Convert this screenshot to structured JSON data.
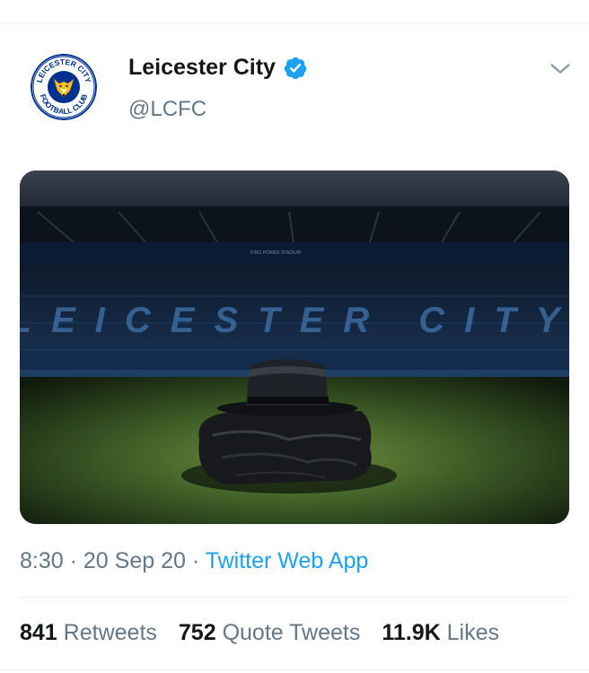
{
  "tweet": {
    "display_name": "Leicester City",
    "handle": "@LCFC",
    "time": "8:30",
    "date": "20 Sep 20",
    "source": "Twitter Web App",
    "separator": "·"
  },
  "stats": {
    "retweets_count": "841",
    "retweets_label": "Retweets",
    "quotes_count": "752",
    "quotes_label": "Quote Tweets",
    "likes_count": "11.9K",
    "likes_label": "Likes"
  },
  "media": {
    "stadium_sign": "KING POWER STADIUM",
    "stand_lettering": "LEICESTER CITY"
  },
  "avatar": {
    "badge_text_top": "LEICESTER CITY",
    "badge_text_bottom": "FOOTBALL CLUB"
  },
  "colors": {
    "accent": "#1da1f2",
    "secondary_text": "#657786",
    "primary_text": "#14171a",
    "divider": "#e6ecf0",
    "club_blue": "#003090",
    "club_gold": "#fdbe11"
  },
  "icons": {
    "verified": "verified-badge-icon",
    "caret": "chevron-down-icon",
    "avatar": "leicester-city-crest-icon"
  }
}
